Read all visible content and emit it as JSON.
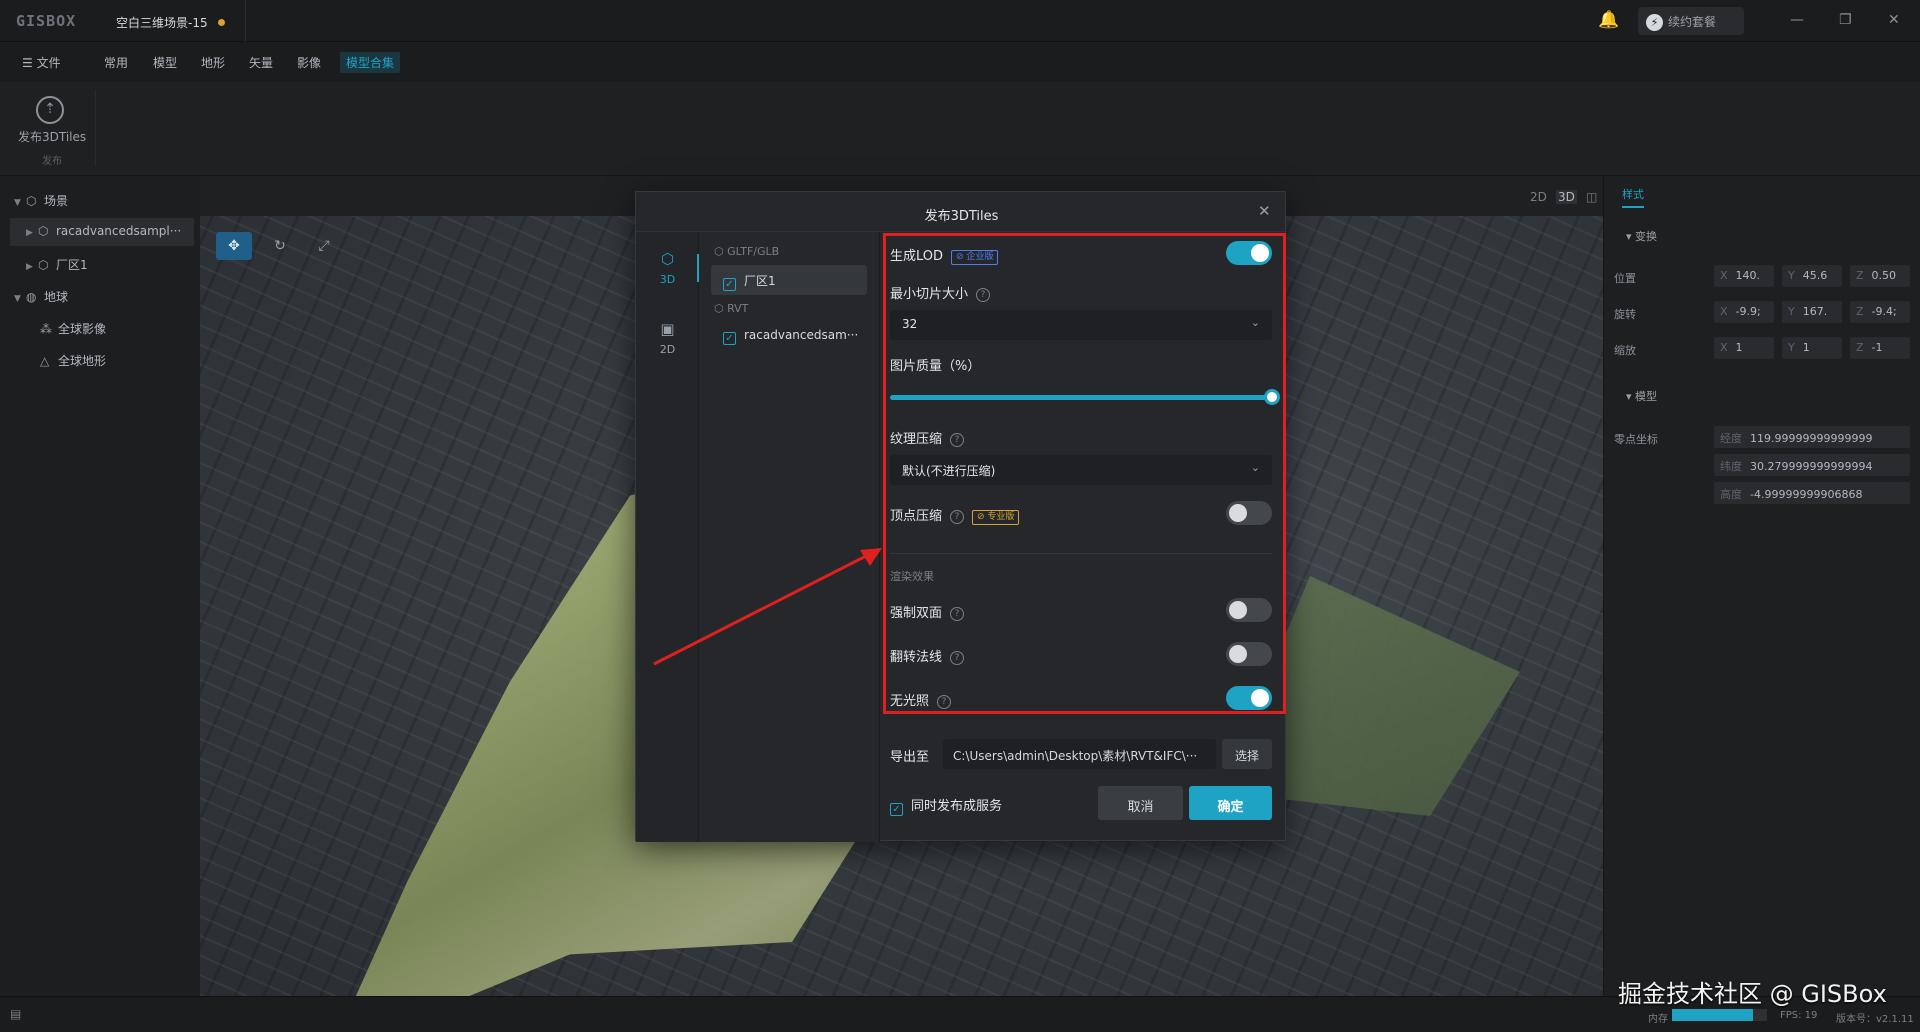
{
  "app": {
    "logo": "GISBOX",
    "doc_tab": "空白三维场景-15",
    "renew_label": "续约套餐"
  },
  "menu": {
    "file": "☰ 文件",
    "items": [
      "常用",
      "模型",
      "地形",
      "矢量",
      "影像",
      "模型合集"
    ]
  },
  "ribbon": {
    "publish_label": "发布3DTiles",
    "group_label": "发布"
  },
  "tree": {
    "scene": "场景",
    "model1": "racadvancedsampl···",
    "model2": "厂区1",
    "globe": "地球",
    "imagery": "全球影像",
    "terrain": "全球地形"
  },
  "view_modes": [
    "2D",
    "3D"
  ],
  "right_panel": {
    "tab": "样式",
    "transform": "变换",
    "position": "位置",
    "rotation": "旋转",
    "scale": "缩放",
    "pos": {
      "x": "140.",
      "y": "45.6",
      "z": "0.50"
    },
    "rot": {
      "x": "-9.9;",
      "y": "167.",
      "z": "-9.4;"
    },
    "scl": {
      "x": "1",
      "y": "1",
      "z": "-1"
    },
    "model_section": "模型",
    "origin": "零点坐标",
    "lon_label": "经度",
    "lat_label": "纬度",
    "alt_label": "高度",
    "lon": "119.99999999999999",
    "lat": "30.279999999999994",
    "alt": "-4.99999999906868"
  },
  "dialog": {
    "title": "发布3DTiles",
    "side_3d": "3D",
    "side_2d": "2D",
    "group_gltf": "GLTF/GLB",
    "item_gltf": "厂区1",
    "group_rvt": "RVT",
    "item_rvt": "racadvancedsam···",
    "gen_lod": "生成LOD",
    "enterprise_badge": "企业版",
    "min_tile": "最小切片大小",
    "min_tile_value": "32",
    "img_quality": "图片质量（%）",
    "img_quality_value": 100,
    "tex_compress": "纹理压缩",
    "tex_compress_value": "默认(不进行压缩)",
    "vertex_compress": "顶点压缩",
    "pro_badge": "专业版",
    "render_section": "渲染效果",
    "double_side": "强制双面",
    "flip_normal": "翻转法线",
    "unlit": "无光照",
    "export_label": "导出至",
    "export_path": "C:\\Users\\admin\\Desktop\\素材\\RVT&IFC\\···",
    "choose": "选择",
    "publish_service": "同时发布成服务",
    "cancel": "取消",
    "ok": "确定",
    "toggles": {
      "gen_lod": true,
      "vertex_compress": false,
      "double_side": false,
      "flip_normal": false,
      "unlit": true
    }
  },
  "status": {
    "watermark": "掘金技术社区 @ GISBox",
    "mem_label": "内存",
    "mem_fraction": 0.85,
    "fps": "FPS: 19",
    "version": "版本号：v2.1.11"
  },
  "colors": {
    "accent": "#1fa3c4",
    "highlight_frame": "#e02020",
    "pro_badge": "#d6a23a",
    "enterprise_badge": "#4f7df0"
  }
}
